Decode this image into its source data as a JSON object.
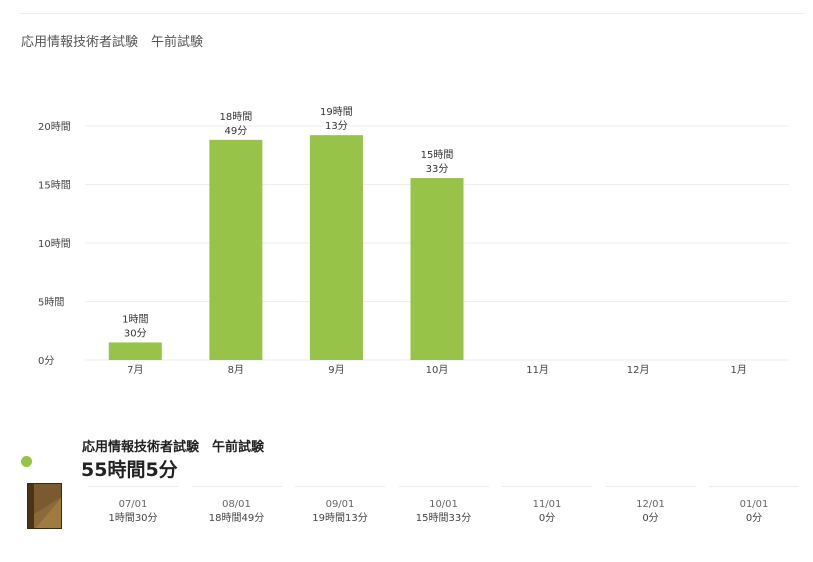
{
  "header": {
    "title": "応用情報技術者試験　午前試験"
  },
  "chart_data": {
    "type": "bar",
    "categories": [
      "7月",
      "8月",
      "9月",
      "10月",
      "11月",
      "12月",
      "1月"
    ],
    "series": [
      {
        "name": "応用情報技術者試験　午前試験",
        "values_minutes": [
          90,
          1129,
          1153,
          933,
          0,
          0,
          0
        ],
        "data_labels": [
          [
            "1時間",
            "30分"
          ],
          [
            "18時間",
            "49分"
          ],
          [
            "19時間",
            "13分"
          ],
          [
            "15時間",
            "33分"
          ],
          null,
          null,
          null
        ]
      }
    ],
    "y_ticks": [
      {
        "value_minutes": 0,
        "label": "0分"
      },
      {
        "value_minutes": 300,
        "label": "5時間"
      },
      {
        "value_minutes": 600,
        "label": "10時間"
      },
      {
        "value_minutes": 900,
        "label": "15時間"
      },
      {
        "value_minutes": 1200,
        "label": "20時間"
      }
    ],
    "ylim_minutes": [
      0,
      1200
    ],
    "grid": true,
    "bar_color": "#97c348"
  },
  "legend": {
    "dot_color": "#97c348",
    "name": "応用情報技術者試験　午前試験",
    "total": "55時間5分",
    "icon": "book-icon",
    "months": [
      {
        "date": "07/01",
        "time": "1時間30分"
      },
      {
        "date": "08/01",
        "time": "18時間49分"
      },
      {
        "date": "09/01",
        "time": "19時間13分"
      },
      {
        "date": "10/01",
        "time": "15時間33分"
      },
      {
        "date": "11/01",
        "time": "0分"
      },
      {
        "date": "12/01",
        "time": "0分"
      },
      {
        "date": "01/01",
        "time": "0分"
      }
    ]
  }
}
